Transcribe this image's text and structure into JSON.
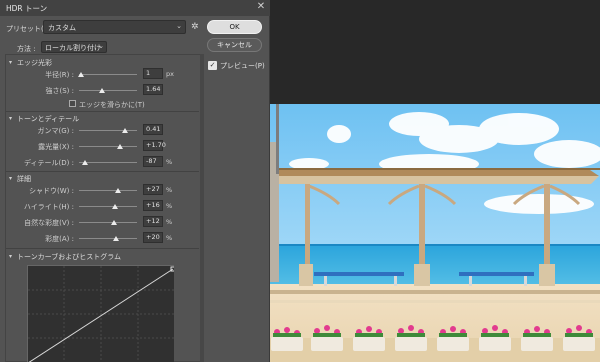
{
  "dialog": {
    "title": "HDR トーン",
    "close_icon": "close-icon"
  },
  "preset": {
    "label": "プリセット(E) :",
    "value": "カスタム"
  },
  "buttons": {
    "ok": "OK",
    "cancel": "キャンセル"
  },
  "preview": {
    "label": "プレビュー(P)",
    "checked": true
  },
  "method": {
    "label": "方法 :",
    "value": "ローカル割り付け"
  },
  "edge_glow": {
    "title": "エッジ光彩",
    "radius": {
      "label": "半径(R) :",
      "value": "1",
      "unit": "px"
    },
    "strength": {
      "label": "強さ(S) :",
      "value": "1.64"
    },
    "smooth_edges": {
      "label": "エッジを滑らかに(T)",
      "checked": false
    }
  },
  "tone_detail": {
    "title": "トーンとディテール",
    "gamma": {
      "label": "ガンマ(G) :",
      "value": "0.41"
    },
    "exposure": {
      "label": "露光量(X) :",
      "value": "+1.70"
    },
    "detail": {
      "label": "ディテール(D) :",
      "value": "-87",
      "unit": "%"
    }
  },
  "advanced": {
    "title": "詳細",
    "shadow": {
      "label": "シャドウ(W) :",
      "value": "+27",
      "unit": "%"
    },
    "highlight": {
      "label": "ハイライト(H) :",
      "value": "+16",
      "unit": "%"
    },
    "vibrance": {
      "label": "自然な彩度(V) :",
      "value": "+12",
      "unit": "%"
    },
    "saturation": {
      "label": "彩度(A) :",
      "value": "+20",
      "unit": "%"
    }
  },
  "curve": {
    "title": "トーンカーブおよびヒストグラム"
  },
  "colors": {
    "dialog_bg": "#535353",
    "workspace_bg": "#282828",
    "sky": "#8fd0f5",
    "sea": "#1e9fd6"
  }
}
